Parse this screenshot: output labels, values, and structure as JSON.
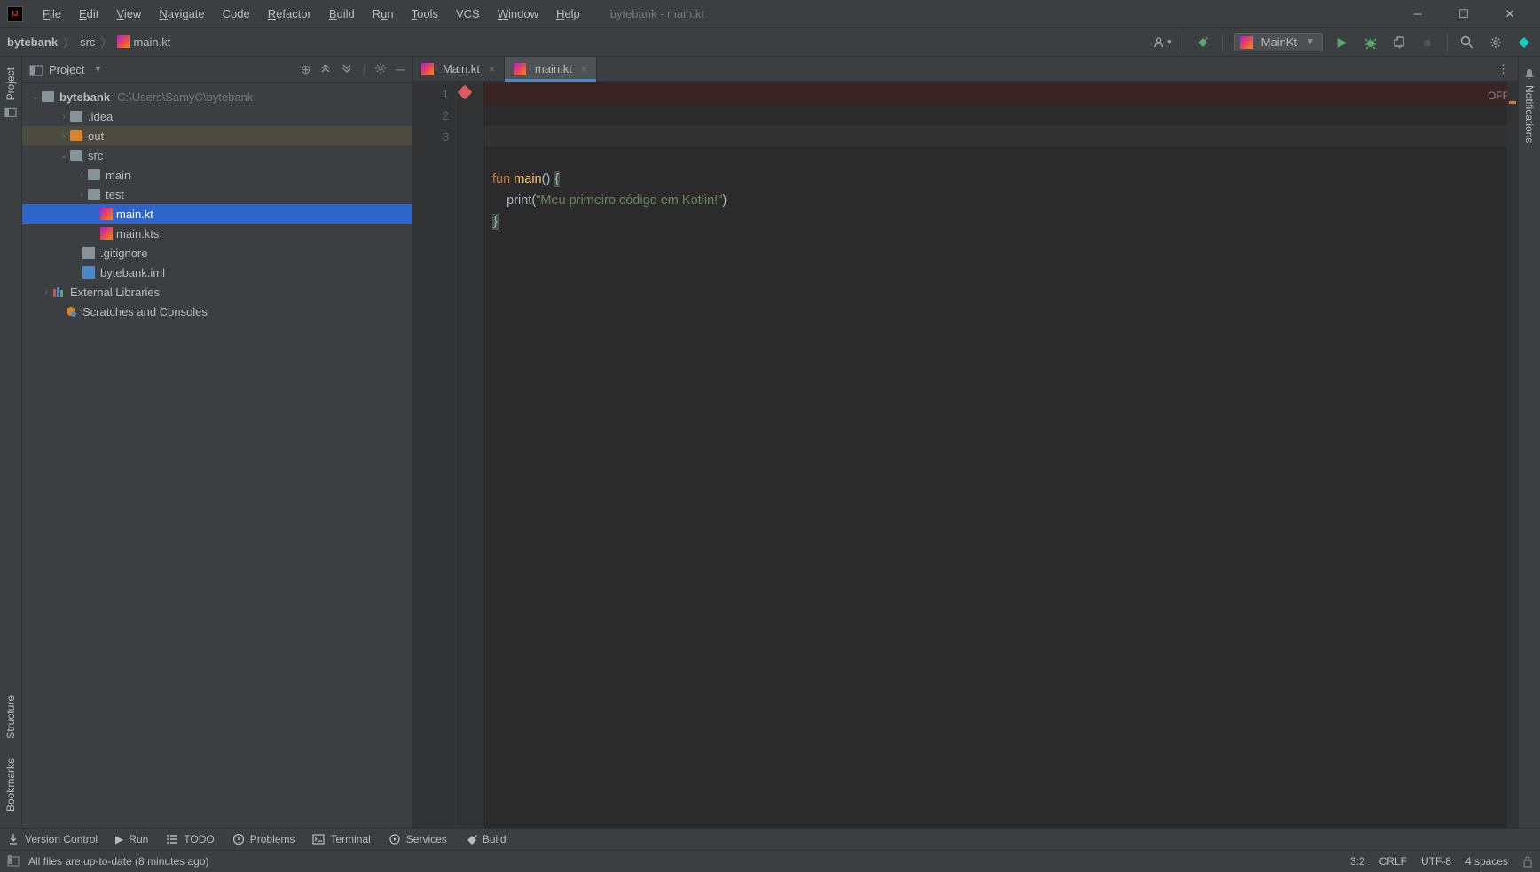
{
  "app": {
    "title": "bytebank - main.kt"
  },
  "menu": {
    "file": "File",
    "edit": "Edit",
    "view": "View",
    "navigate": "Navigate",
    "code": "Code",
    "refactor": "Refactor",
    "build": "Build",
    "run": "Run",
    "tools": "Tools",
    "vcs": "VCS",
    "window": "Window",
    "help": "Help"
  },
  "breadcrumb": {
    "project": "bytebank",
    "folder": "src",
    "file": "main.kt"
  },
  "run_config": {
    "name": "MainKt"
  },
  "left_tabs": {
    "project": "Project",
    "structure": "Structure",
    "bookmarks": "Bookmarks"
  },
  "right_tabs": {
    "notifications": "Notifications"
  },
  "project_panel": {
    "title": "Project",
    "root": {
      "name": "bytebank",
      "path": "C:\\Users\\SamyC\\bytebank"
    },
    "idea": ".idea",
    "out": "out",
    "src": "src",
    "main": "main",
    "test": "test",
    "main_kt": "main.kt",
    "main_kts": "main.kts",
    "gitignore": ".gitignore",
    "iml": "bytebank.iml",
    "ext_libs": "External Libraries",
    "scratches": "Scratches and Consoles"
  },
  "tabs": {
    "tab1": "Main.kt",
    "tab2": "main.kt"
  },
  "editor": {
    "line_numbers": [
      "1",
      "2",
      "3"
    ],
    "code": {
      "kw_fun": "fun ",
      "fn_main": "main",
      "parens_open": "() ",
      "brace_open": "{",
      "indent": "    ",
      "print": "print",
      "po": "(",
      "string": "\"Meu primeiro código em Kotlin!\"",
      "pc": ")",
      "brace_close": "}"
    },
    "inspection": "OFF"
  },
  "bottom_tools": {
    "vcs": "Version Control",
    "run": "Run",
    "todo": "TODO",
    "problems": "Problems",
    "terminal": "Terminal",
    "services": "Services",
    "build": "Build"
  },
  "status": {
    "message": "All files are up-to-date (8 minutes ago)",
    "caret": "3:2",
    "line_sep": "CRLF",
    "encoding": "UTF-8",
    "indent": "4 spaces"
  }
}
